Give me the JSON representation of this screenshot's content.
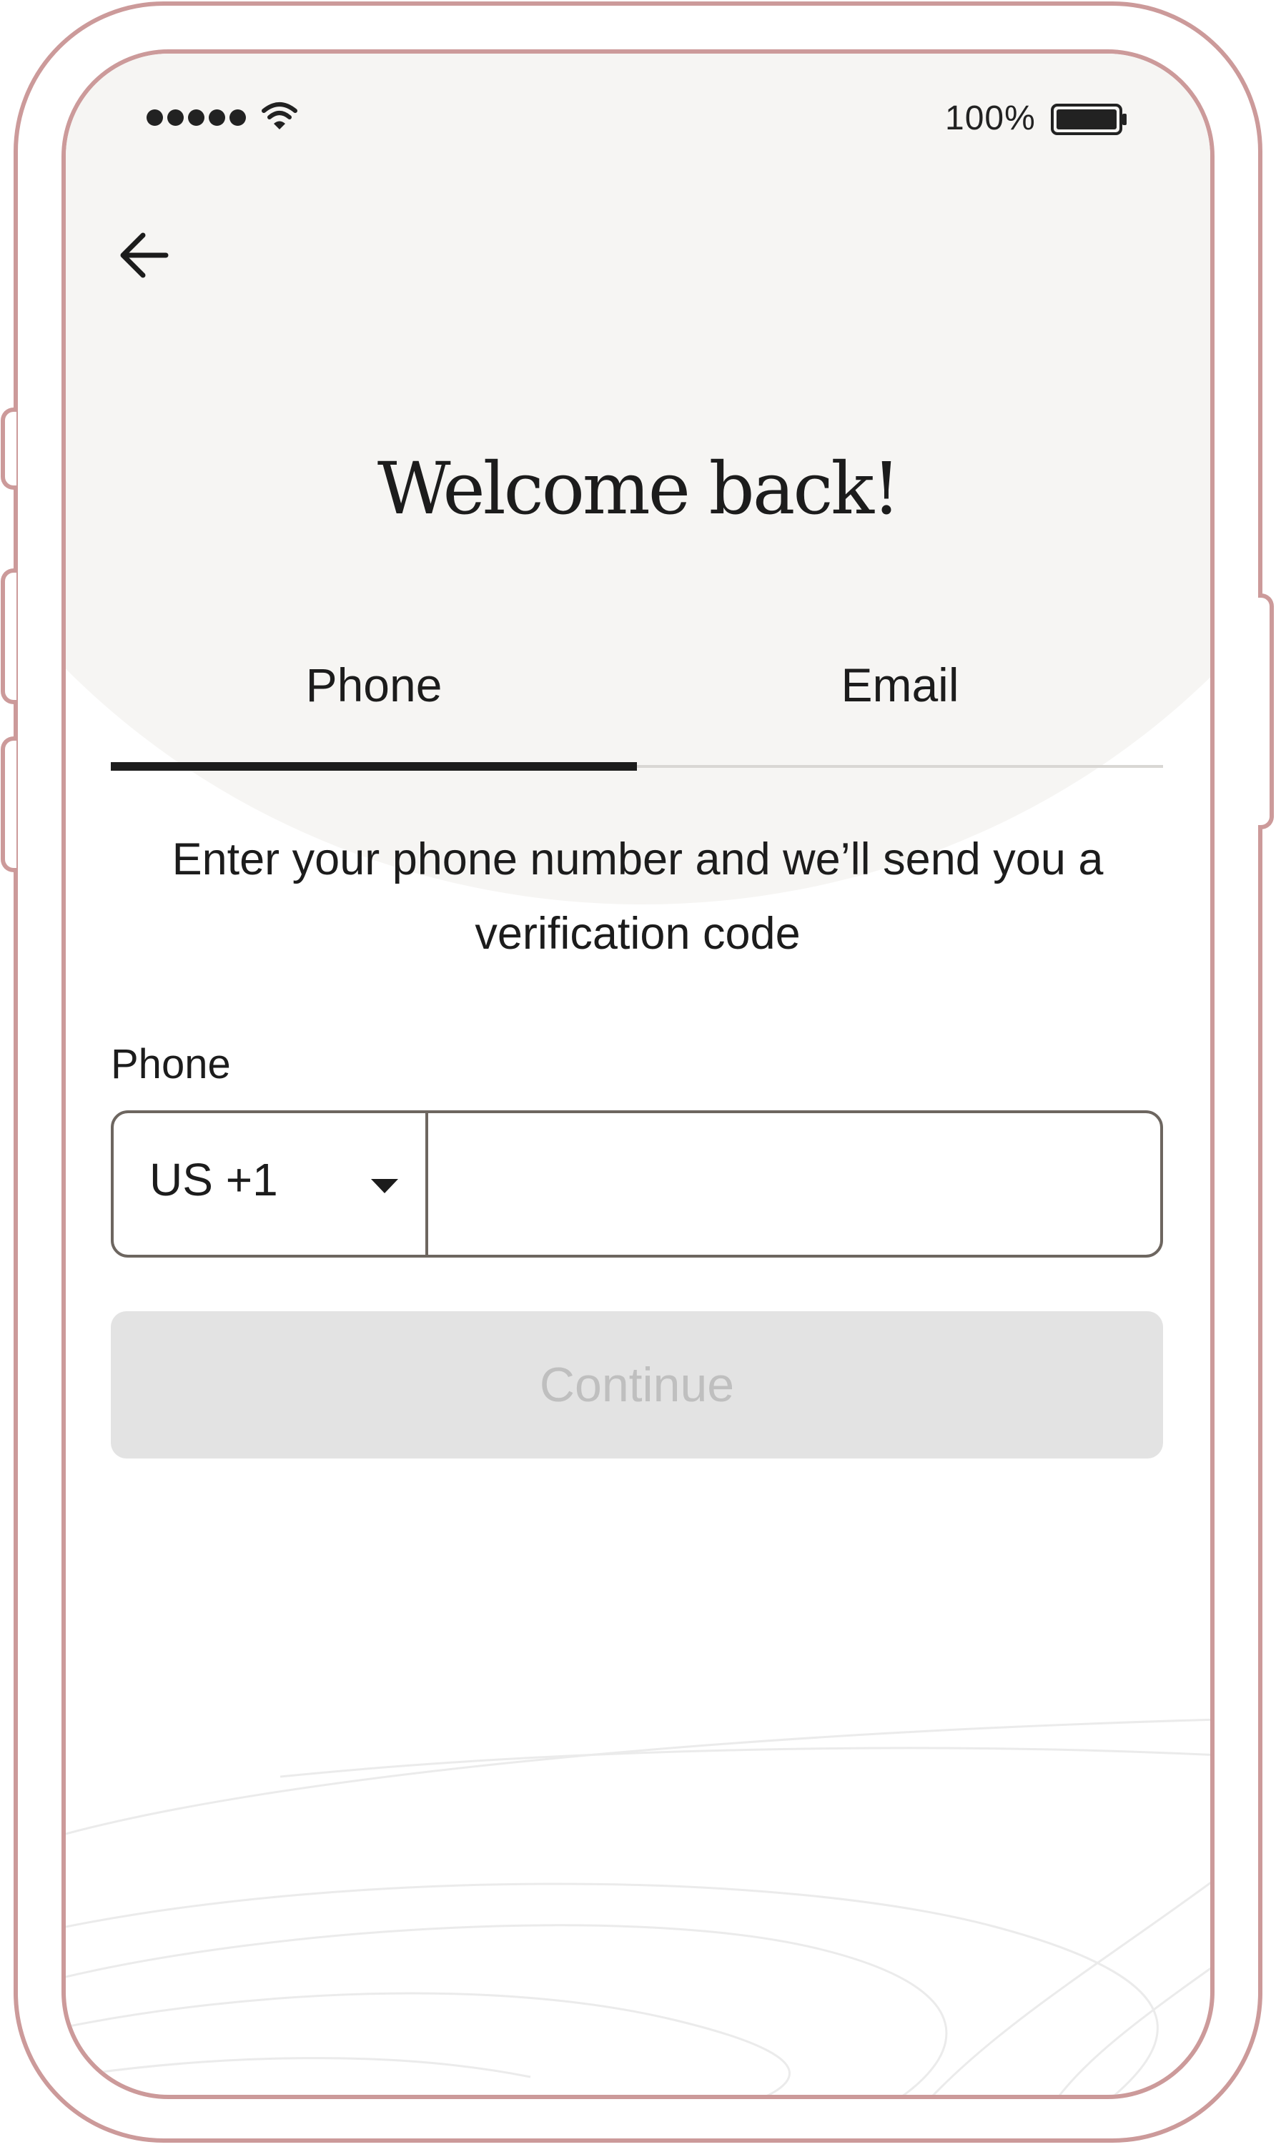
{
  "status_bar": {
    "battery_percent": "100%",
    "signal_bars": 5,
    "battery_level": 1.0
  },
  "header": {
    "back_icon": "arrow-left-icon",
    "title": "Welcome back!"
  },
  "tabs": [
    {
      "label": "Phone",
      "active": true
    },
    {
      "label": "Email",
      "active": false
    }
  ],
  "description": "Enter your phone number and we’ll send you a verification code",
  "phone_form": {
    "label": "Phone",
    "country_code": "US +1",
    "dropdown_icon": "caret-down-icon",
    "number_value": "",
    "number_placeholder": ""
  },
  "continue_button": {
    "label": "Continue",
    "enabled": false
  },
  "colors": {
    "frame": "#cc9a9a",
    "top_background": "#f6f5f3",
    "text": "#1c1c1c",
    "disabled_button": "#e3e3e3",
    "disabled_text": "#bfbfbf"
  }
}
